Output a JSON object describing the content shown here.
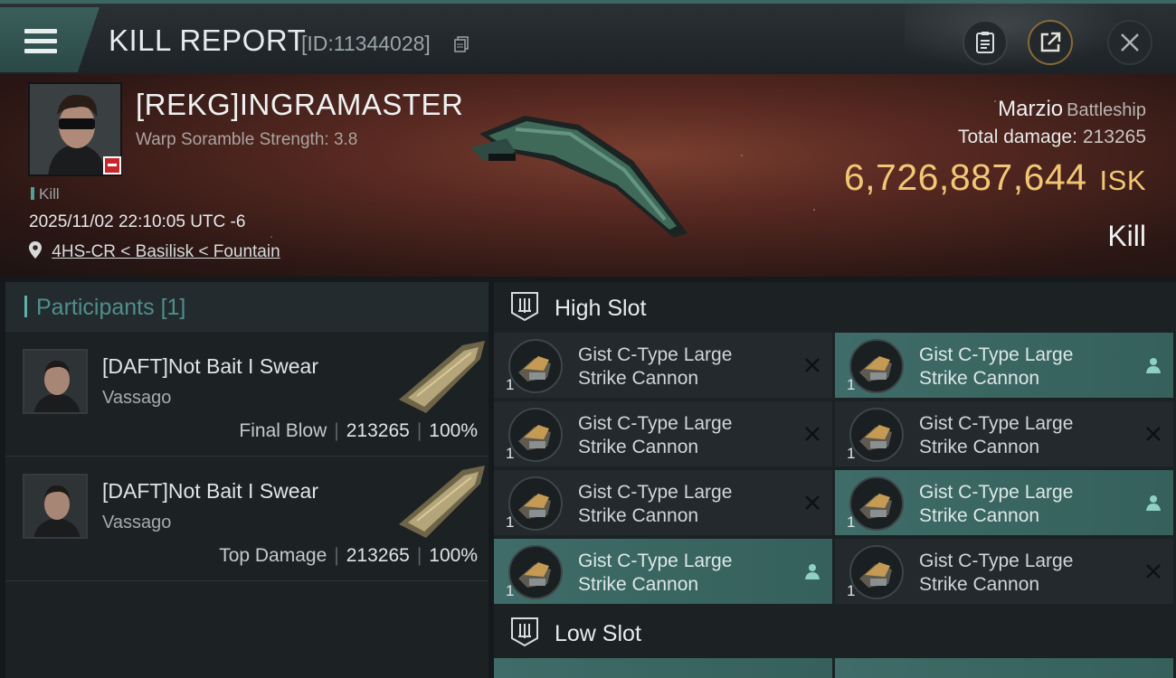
{
  "header": {
    "title": "KILL REPORT",
    "id_text": "[ID:11344028]"
  },
  "victim": {
    "name": "[REKG]INGRAMASTER",
    "warp_scramble": "Warp Soramble Strength: 3.8",
    "kill_tag": "Kill",
    "timestamp": "2025/11/02 22:10:05 UTC -6",
    "location": "4HS-CR < Basilisk < Fountain",
    "ship_name": "Marzio",
    "ship_class": "Battleship",
    "total_damage_label": "Total damage:",
    "total_damage_value": "213265",
    "isk_value": "6,726,887,644",
    "isk_unit": "ISK",
    "result": "Kill"
  },
  "participants": {
    "title": "Participants",
    "count": "[1]",
    "rows": [
      {
        "name": "[DAFT]Not Bait I Swear",
        "ship": "Vassago",
        "role": "Final Blow",
        "damage": "213265",
        "percent": "100%"
      },
      {
        "name": "[DAFT]Not Bait I Swear",
        "ship": "Vassago",
        "role": "Top Damage",
        "damage": "213265",
        "percent": "100%"
      }
    ]
  },
  "slots": {
    "high_title": "High Slot",
    "low_title": "Low Slot",
    "high_modules": [
      {
        "name": "Gist C-Type Large Strike Cannon",
        "qty": "1",
        "status": "destroyed"
      },
      {
        "name": "Gist C-Type Large Strike Cannon",
        "qty": "1",
        "status": "dropped"
      },
      {
        "name": "Gist C-Type Large Strike Cannon",
        "qty": "1",
        "status": "destroyed"
      },
      {
        "name": "Gist C-Type Large Strike Cannon",
        "qty": "1",
        "status": "destroyed"
      },
      {
        "name": "Gist C-Type Large Strike Cannon",
        "qty": "1",
        "status": "destroyed"
      },
      {
        "name": "Gist C-Type Large Strike Cannon",
        "qty": "1",
        "status": "dropped"
      },
      {
        "name": "Gist C-Type Large Strike Cannon",
        "qty": "1",
        "status": "dropped"
      },
      {
        "name": "Gist C-Type Large Strike Cannon",
        "qty": "1",
        "status": "destroyed"
      }
    ]
  },
  "colors": {
    "accent_teal": "#3f6c68",
    "isk_gold": "#f3c676",
    "corp_red": "#c8262a"
  }
}
